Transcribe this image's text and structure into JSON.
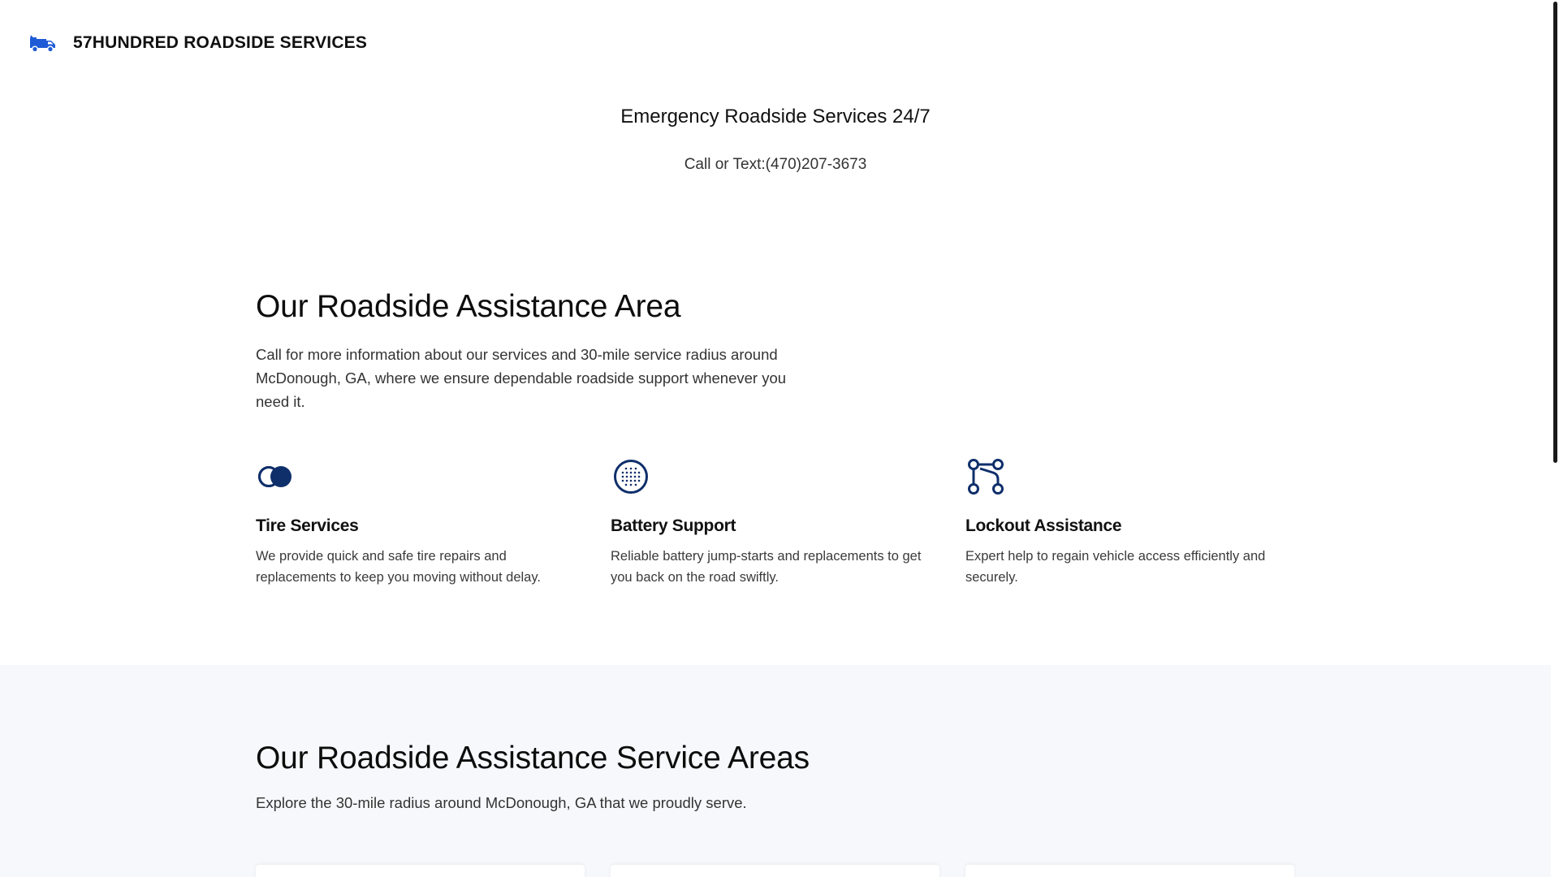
{
  "header": {
    "brand_name": "57HUNDRED ROADSIDE SERVICES",
    "brand_icon": "tow-truck-icon",
    "accent_color": "#1f5bd6"
  },
  "hero": {
    "title": "Emergency Roadside Services 24/7",
    "subtitle": "Call or Text:(470)207-3673"
  },
  "assistance_area": {
    "title": "Our Roadside Assistance Area",
    "description": "Call for more information about our services and 30-mile service radius around McDonough, GA, where we ensure dependable roadside support whenever you need it.",
    "features": [
      {
        "icon": "overlapping-circles-icon",
        "title": "Tire Services",
        "description": "We provide quick and safe tire repairs and replacements to keep you moving without delay."
      },
      {
        "icon": "dotted-circle-icon",
        "title": "Battery Support",
        "description": "Reliable battery jump-starts and replacements to get you back on the road swiftly."
      },
      {
        "icon": "nodes-route-icon",
        "title": "Lockout Assistance",
        "description": "Expert help to regain vehicle access efficiently and securely."
      }
    ],
    "icon_color": "#0f2f6b"
  },
  "service_areas": {
    "title": "Our Roadside Assistance Service Areas",
    "description": "Explore the 30-mile radius around McDonough, GA that we proudly serve.",
    "background_color": "#f6f8fb"
  }
}
